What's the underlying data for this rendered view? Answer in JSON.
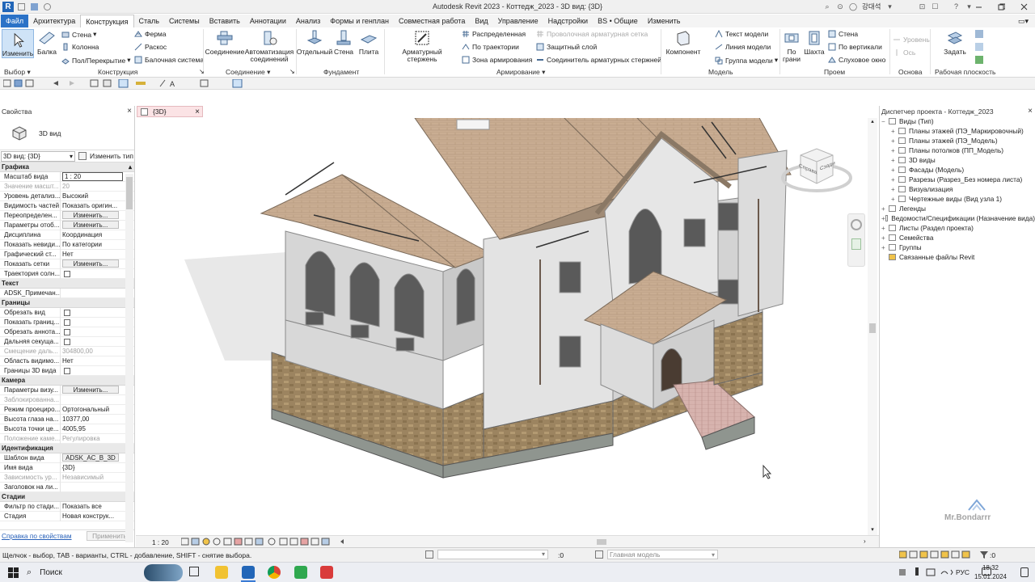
{
  "title_bar": {
    "title": "Autodesk Revit 2023 - Коттедж_2023 - 3D вид: {3D}",
    "user": "강대석"
  },
  "menu_tabs": [
    "Файл",
    "Архитектура",
    "Конструкция",
    "Сталь",
    "Системы",
    "Вставить",
    "Аннотации",
    "Анализ",
    "Формы и генплан",
    "Совместная работа",
    "Вид",
    "Управление",
    "Надстройки",
    "BS • Общие",
    "Изменить"
  ],
  "ribbon": {
    "modify": "Изменить",
    "beam": "Балка",
    "wall": "Стена",
    "column": "Колонна",
    "floor": "Пол/Перекрытие",
    "truss": "Ферма",
    "brace": "Раскос",
    "beam_system": "Балочная система",
    "connection": "Соединение",
    "automation_1": "Автоматизация",
    "automation_2": "соединений",
    "isolated": "Отдельный",
    "wall_found": "Стена",
    "slab": "Плита",
    "rebar": "Арматурный стержень",
    "area": "Распределенная",
    "path": "По траектории",
    "area_rein": "Зона армирования",
    "fabric_sheet": "Проволочная арматурная сетка",
    "cover": "Защитный слой",
    "couplers": "Соединитель арматурных стержней",
    "component": "Компонент",
    "model_text": "Текст модели",
    "model_line": "Линия модели",
    "model_group": "Группа модели",
    "by_face_1": "По",
    "by_face_2": "грани",
    "shaft": "Шахта",
    "op_wall": "Стена",
    "vertical": "По вертикали",
    "dormer": "Слуховое окно",
    "level": "Уровень",
    "grid": "Ось",
    "set": "Задать",
    "panels": {
      "select": "Выбор",
      "structure": "Конструкция",
      "connection": "Соединение",
      "foundation": "Фундамент",
      "reinforcement": "Армирование",
      "model": "Модель",
      "opening": "Проем",
      "datum": "Основа",
      "workplane": "Рабочая плоскость"
    }
  },
  "properties": {
    "header": "Свойства",
    "type_name": "3D вид",
    "selector": "3D вид: {3D}",
    "edit_type": "Изменить тип",
    "groups": [
      {
        "name": "Графика",
        "rows": [
          {
            "k": "Масштаб вида",
            "v": "1 : 20",
            "kind": "input"
          },
          {
            "k": "Значение масшт...",
            "v": "20",
            "kind": "dim"
          },
          {
            "k": "Уровень детализ...",
            "v": "Высокий"
          },
          {
            "k": "Видимость частей",
            "v": "Показать оригин..."
          },
          {
            "k": "Переопределен...",
            "v": "Изменить...",
            "kind": "button"
          },
          {
            "k": "Параметры отоб...",
            "v": "Изменить...",
            "kind": "button"
          },
          {
            "k": "Дисциплина",
            "v": "Координация"
          },
          {
            "k": "Показать невиди...",
            "v": "По категории"
          },
          {
            "k": "Графический ст...",
            "v": "Нет"
          },
          {
            "k": "Показать сетки",
            "v": "Изменить...",
            "kind": "button"
          },
          {
            "k": "Траектория солн...",
            "v": "",
            "kind": "check"
          }
        ]
      },
      {
        "name": "Текст",
        "rows": [
          {
            "k": "ADSK_Примечан...",
            "v": ""
          }
        ]
      },
      {
        "name": "Границы",
        "rows": [
          {
            "k": "Обрезать вид",
            "v": "",
            "kind": "check"
          },
          {
            "k": "Показать границ...",
            "v": "",
            "kind": "check"
          },
          {
            "k": "Обрезать аннота...",
            "v": "",
            "kind": "check"
          },
          {
            "k": "Дальняя секуща...",
            "v": "",
            "kind": "check"
          },
          {
            "k": "Смещение даль...",
            "v": "304800,00",
            "kind": "dim"
          },
          {
            "k": "Область видимо...",
            "v": "Нет"
          },
          {
            "k": "Границы 3D вида",
            "v": "",
            "kind": "check"
          }
        ]
      },
      {
        "name": "Камера",
        "rows": [
          {
            "k": "Параметры визу...",
            "v": "Изменить...",
            "kind": "button"
          },
          {
            "k": "Заблокированна...",
            "v": "",
            "kind": "dim"
          },
          {
            "k": "Режим проециро...",
            "v": "Ортогональный"
          },
          {
            "k": "Высота глаза на...",
            "v": "10377,00"
          },
          {
            "k": "Высота точки це...",
            "v": "4005,95"
          },
          {
            "k": "Положение каме...",
            "v": "Регулировка",
            "kind": "dim"
          }
        ]
      },
      {
        "name": "Идентификация",
        "rows": [
          {
            "k": "Шаблон вида",
            "v": "ADSK_АС_В_3D",
            "kind": "button"
          },
          {
            "k": "Имя вида",
            "v": "{3D}"
          },
          {
            "k": "Зависимость ур...",
            "v": "Независимый",
            "kind": "dim"
          },
          {
            "k": "Заголовок на ли...",
            "v": ""
          }
        ]
      },
      {
        "name": "Стадии",
        "rows": [
          {
            "k": "Фильтр по стади...",
            "v": "Показать все"
          },
          {
            "k": "Стадия",
            "v": "Новая конструк..."
          }
        ]
      }
    ],
    "help_link": "Справка по свойствам",
    "apply": "Применить"
  },
  "view": {
    "tab_label": "{3D}",
    "scale": "1 : 20",
    "viewcube_left": "Справа",
    "viewcube_right": "Сзади"
  },
  "browser": {
    "header": "Диспетчер проекта - Коттедж_2023",
    "items": [
      {
        "label": "Виды (Тип)",
        "level": 0,
        "toggle": "−"
      },
      {
        "label": "Планы этажей (ПЭ_Маркировочный)",
        "level": 1,
        "toggle": "+"
      },
      {
        "label": "Планы этажей (ПЭ_Модель)",
        "level": 1,
        "toggle": "+"
      },
      {
        "label": "Планы потолков (ПП_Модель)",
        "level": 1,
        "toggle": "+"
      },
      {
        "label": "3D виды",
        "level": 1,
        "toggle": "+"
      },
      {
        "label": "Фасады (Модель)",
        "level": 1,
        "toggle": "+"
      },
      {
        "label": "Разрезы (Разрез_Без номера листа)",
        "level": 1,
        "toggle": "+"
      },
      {
        "label": "Визуализация",
        "level": 1,
        "toggle": "+"
      },
      {
        "label": "Чертежные виды (Вид узла 1)",
        "level": 1,
        "toggle": "+"
      },
      {
        "label": "Легенды",
        "level": 0,
        "toggle": "+"
      },
      {
        "label": "Ведомости/Спецификации (Назначение вида)",
        "level": 0,
        "toggle": "+"
      },
      {
        "label": "Листы (Раздел проекта)",
        "level": 0,
        "toggle": "+"
      },
      {
        "label": "Семейства",
        "level": 0,
        "toggle": "+"
      },
      {
        "label": "Группы",
        "level": 0,
        "toggle": "+"
      },
      {
        "label": "Связанные файлы Revit",
        "level": 0,
        "toggle": ""
      }
    ],
    "watermark": "Mr.Bondarrr"
  },
  "status": {
    "hint": "Щелчок - выбор, TAB - варианты, CTRL - добавление, SHIFT - снятие выбора.",
    "count": ":0",
    "model": "Главная модель",
    "filter_count": ":0"
  },
  "taskbar": {
    "search": "Поиск",
    "lang": "РУС",
    "time": "18:32",
    "date": "15.01.2024"
  }
}
